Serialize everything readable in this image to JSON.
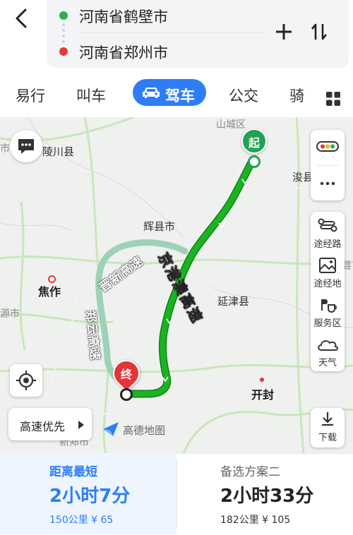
{
  "header": {
    "start": "河南省鹤壁市",
    "end": "河南省郑州市"
  },
  "tabs": [
    {
      "label": "易行"
    },
    {
      "label": "叫车"
    },
    {
      "label": "驾车",
      "active": true
    },
    {
      "label": "公交"
    },
    {
      "label": "骑"
    }
  ],
  "map": {
    "places": {
      "shancheng": "山城区",
      "lingchuan": "陵川县",
      "xun": "浚县",
      "huixian": "辉县市",
      "jiaozuo": "焦作",
      "yanjin": "延津县",
      "kaifeng": "开封",
      "xinzheng": "新郑市",
      "left_edge": "市",
      "left_edge2": "源市",
      "right_edge": "县"
    },
    "roads": {
      "jingang_ao": "京港澳高速",
      "jinxin": "晋新高速",
      "zhengyun": "郑云高速"
    },
    "markers": {
      "start": "起",
      "end": "终"
    },
    "logo": "高德地图",
    "colors": {
      "route": "#19b521",
      "alt_route": "#9fd1b8",
      "start": "#23a154",
      "end": "#e5343b"
    }
  },
  "controls": {
    "route_preference": "高速优先",
    "side": [
      {
        "label": "途经路"
      },
      {
        "label": "途经地"
      },
      {
        "label": "服务区"
      },
      {
        "label": "天气"
      }
    ],
    "download": "下载"
  },
  "options": [
    {
      "label": "距离最短",
      "time": "2小时7分",
      "meta": "150公里 ¥ 65",
      "selected": true
    },
    {
      "label": "备选方案二",
      "time": "2小时33分",
      "meta": "182公里 ¥ 105"
    }
  ]
}
